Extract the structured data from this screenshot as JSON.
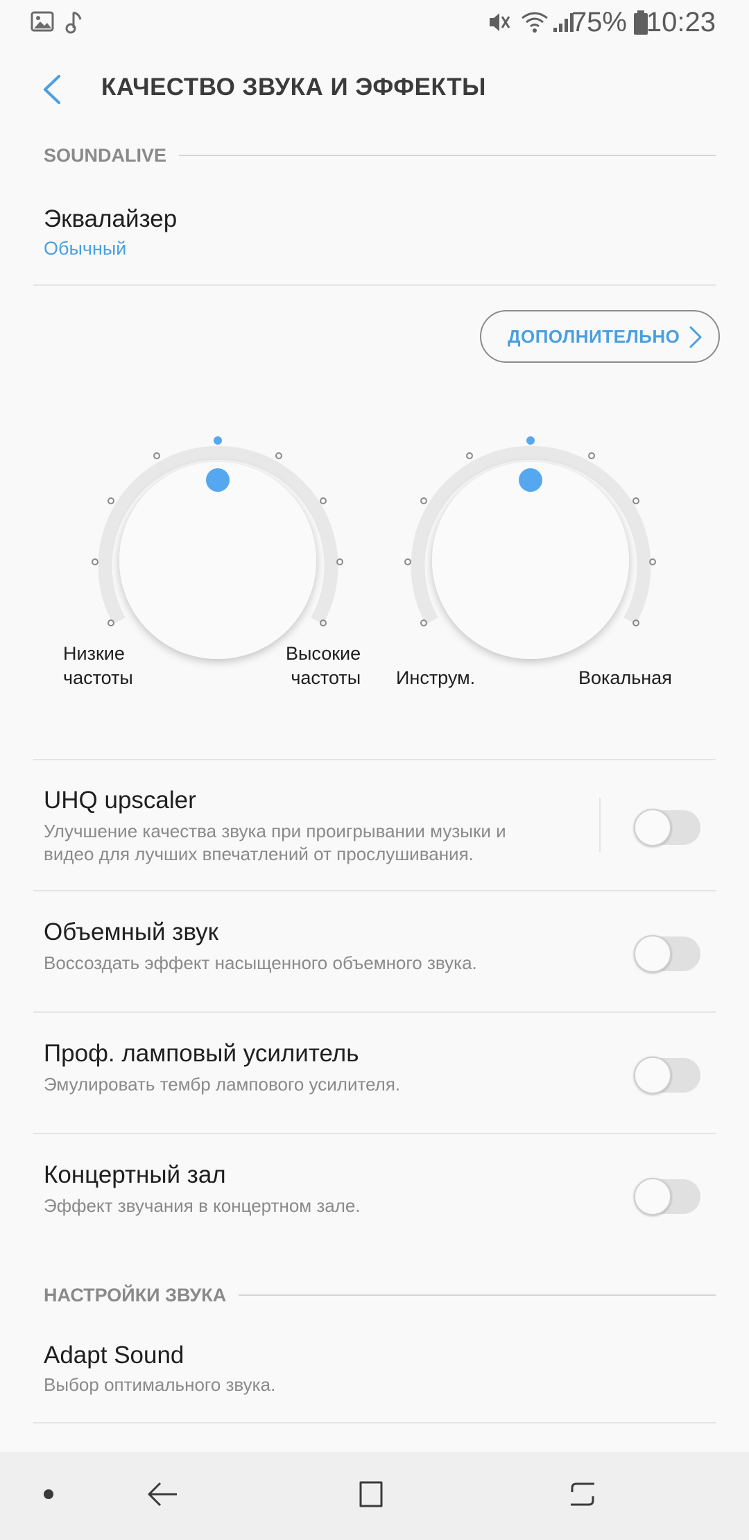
{
  "status_bar": {
    "time": "10:23",
    "battery_percent": "75%",
    "icons": [
      "image-icon",
      "music-note-icon",
      "mute-icon",
      "wifi-icon",
      "signal-icon",
      "battery-icon"
    ]
  },
  "header": {
    "title": "КАЧЕСТВО ЗВУКА И ЭФФЕКТЫ",
    "back_icon": "back-arrow-icon"
  },
  "soundalive": {
    "section_label": "SOUNDALIVE",
    "equalizer": {
      "title": "Эквалайзер",
      "value": "Обычный"
    },
    "advanced_button": "ДОПОЛНИТЕЛЬНО",
    "knobs": [
      {
        "left_label": "Низкие частоты",
        "left_label_lines": [
          "Низкие",
          "частоты"
        ],
        "right_label_lines": [
          "Высокие",
          "частоты"
        ],
        "level": 0
      },
      {
        "left_label_lines": [
          "Инструм."
        ],
        "right_label_lines": [
          "Вокальная"
        ],
        "level": 0
      }
    ]
  },
  "effects": [
    {
      "title": "UHQ upscaler",
      "subtitle_lines": [
        "Улучшение качества звука при проигрывании музыки и",
        "видео для лучших впечатлений от прослушивания."
      ],
      "enabled": false
    },
    {
      "title": "Объемный звук",
      "subtitle_lines": [
        "Воссоздать эффект насыщенного объемного звука."
      ],
      "enabled": false
    },
    {
      "title": "Проф. ламповый усилитель",
      "subtitle_lines": [
        "Эмулировать тембр лампового усилителя."
      ],
      "enabled": false
    },
    {
      "title": "Концертный зал",
      "subtitle_lines": [
        "Эффект звучания в концертном зале."
      ],
      "enabled": false
    }
  ],
  "sound_settings": {
    "section_label": "НАСТРОЙКИ ЗВУКА",
    "adapt_sound": {
      "title": "Adapt Sound",
      "subtitle": "Выбор оптимального звука."
    }
  },
  "colors": {
    "accent": "#4a9fe0",
    "knob_dot": "#55a8f0",
    "background": "#f9f9f9"
  },
  "navbar": {
    "items": [
      "dot-icon",
      "back-icon",
      "home-icon",
      "recents-icon"
    ]
  }
}
